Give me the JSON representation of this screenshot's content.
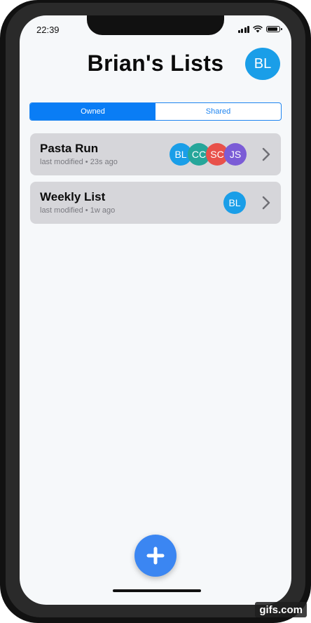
{
  "status_bar": {
    "time": "22:39"
  },
  "header": {
    "title": "Brian's Lists",
    "profile_initials": "BL",
    "profile_color": "#1a9ee8"
  },
  "segmented_control": {
    "options": [
      "Owned",
      "Shared"
    ],
    "selected": "Owned"
  },
  "lists": [
    {
      "name": "Pasta Run",
      "modified": "last modified • 23s ago",
      "members": [
        {
          "initials": "BL",
          "color": "#1a9ee8"
        },
        {
          "initials": "CC",
          "color": "#26a69a"
        },
        {
          "initials": "SC",
          "color": "#e8514a"
        },
        {
          "initials": "JS",
          "color": "#7b5cd6"
        }
      ]
    },
    {
      "name": "Weekly List",
      "modified": "last modified • 1w ago",
      "members": [
        {
          "initials": "BL",
          "color": "#1a9ee8"
        }
      ]
    }
  ],
  "fab": {
    "icon": "plus-icon",
    "color": "#3b86f2"
  },
  "watermark": "gifs.com"
}
